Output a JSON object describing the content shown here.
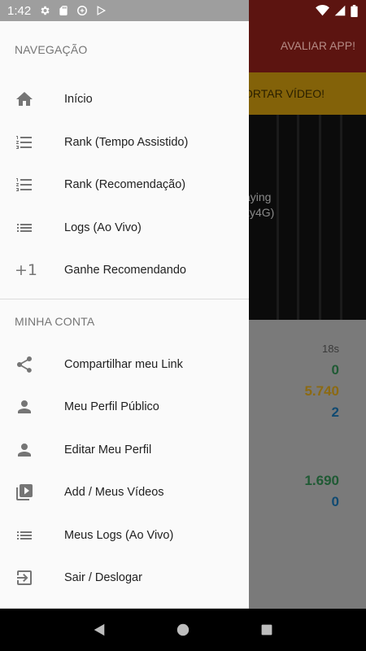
{
  "status_bar": {
    "time": "1:42",
    "icons": [
      "settings-icon",
      "sd-card-icon",
      "data-saver-icon",
      "play-store-icon",
      "wifi-icon",
      "signal-icon",
      "battery-icon"
    ]
  },
  "background_app": {
    "rate_button": "AVALIAR APP!",
    "banner_text": "ORTAR VÍDEO!",
    "video_line1": "aying",
    "video_line2": "xy4G)",
    "stats": {
      "label_time": "18s",
      "v1": "0",
      "v2": "5.740",
      "v3": "2",
      "v4": "1.690",
      "v5": "0"
    },
    "colors": {
      "green": "#1f5a34",
      "gold": "#8c6a12",
      "blue": "#104a72"
    }
  },
  "drawer": {
    "sections": [
      {
        "header": "NAVEGAÇÃO",
        "items": [
          {
            "label": "Início",
            "icon": "home-icon"
          },
          {
            "label": "Rank (Tempo Assistido)",
            "icon": "numbered-list-icon"
          },
          {
            "label": "Rank (Recomendação)",
            "icon": "numbered-list-icon"
          },
          {
            "label": "Logs (Ao Vivo)",
            "icon": "list-icon"
          },
          {
            "label": "Ganhe Recomendando",
            "icon": "plus-one-icon"
          }
        ]
      },
      {
        "header": "MINHA CONTA",
        "items": [
          {
            "label": "Compartilhar meu Link",
            "icon": "share-icon"
          },
          {
            "label": "Meu Perfil Público",
            "icon": "person-icon"
          },
          {
            "label": "Editar Meu Perfil",
            "icon": "person-icon"
          },
          {
            "label": "Add / Meus Vídeos",
            "icon": "video-library-icon"
          },
          {
            "label": "Meus Logs (Ao Vivo)",
            "icon": "list-icon"
          },
          {
            "label": "Sair / Deslogar",
            "icon": "exit-icon"
          }
        ]
      }
    ],
    "plus_one_text": "+1"
  },
  "nav_bar": {
    "icons": [
      "back-icon",
      "home-circle-icon",
      "recents-icon"
    ]
  }
}
